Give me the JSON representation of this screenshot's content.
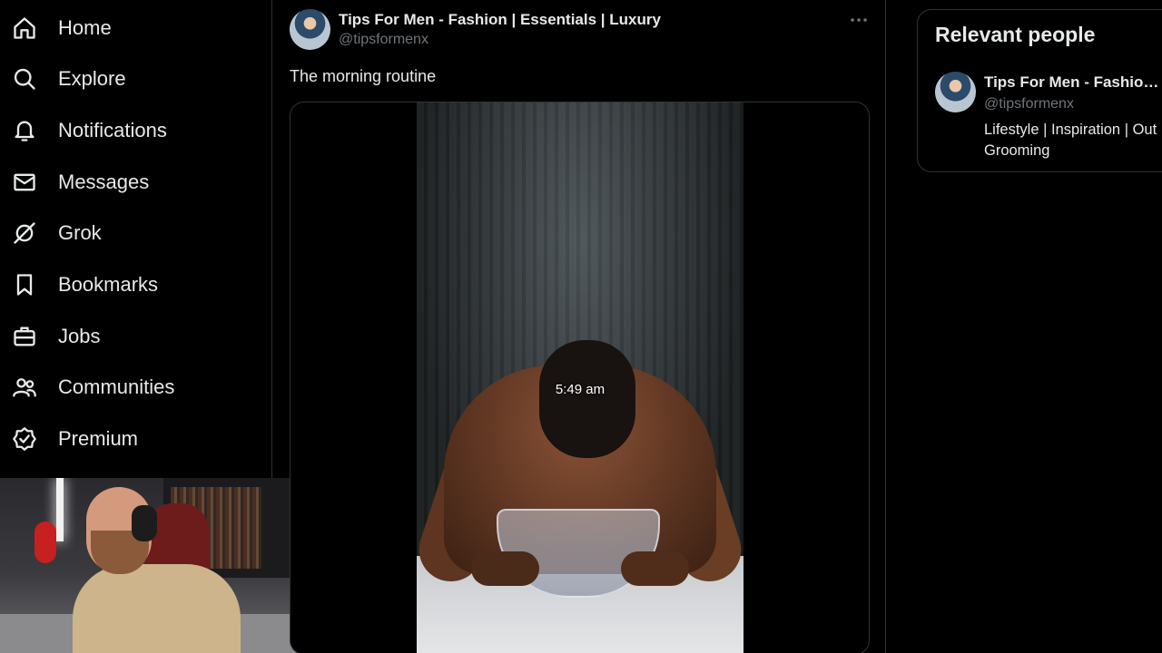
{
  "nav": {
    "items": [
      {
        "label": "Home",
        "icon": "home-icon"
      },
      {
        "label": "Explore",
        "icon": "search-icon"
      },
      {
        "label": "Notifications",
        "icon": "bell-icon"
      },
      {
        "label": "Messages",
        "icon": "envelope-icon"
      },
      {
        "label": "Grok",
        "icon": "grok-icon"
      },
      {
        "label": "Bookmarks",
        "icon": "bookmark-icon"
      },
      {
        "label": "Jobs",
        "icon": "briefcase-icon"
      },
      {
        "label": "Communities",
        "icon": "people-icon"
      },
      {
        "label": "Premium",
        "icon": "verified-badge-icon"
      }
    ]
  },
  "tweet": {
    "author_name": "Tips For Men - Fashion | Essentials | Luxury",
    "author_handle": "@tipsformenx",
    "text": "The morning routine",
    "video_caption": "5:49 am",
    "more_icon": "ellipsis-icon"
  },
  "relevant_people": {
    "title": "Relevant people",
    "person": {
      "name": "Tips For Men - Fashion ...",
      "handle": "@tipsformenx",
      "bio_line1": "Lifestyle | Inspiration | Out",
      "bio_line2": "Grooming"
    }
  },
  "colors": {
    "background": "#000000",
    "text": "#e7e9ea",
    "secondary_text": "#71767b",
    "border": "#2f3336"
  }
}
